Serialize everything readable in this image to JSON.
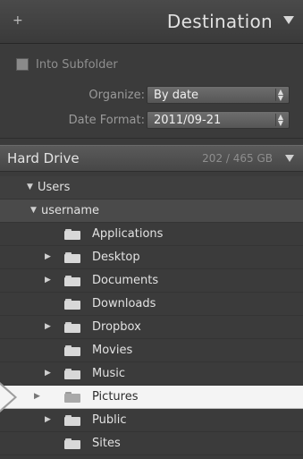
{
  "header": {
    "title": "Destination",
    "plus_icon": "plus-icon",
    "collapse_icon": "triangle-down-icon"
  },
  "subfolder": {
    "label": "Into Subfolder",
    "checked": true
  },
  "organize": {
    "label": "Organize:",
    "value": "By date"
  },
  "date_format": {
    "label": "Date Format:",
    "value": "2011/09-21"
  },
  "drive": {
    "name": "Hard Drive",
    "space": "202 / 465 GB"
  },
  "tree": {
    "users": "Users",
    "username": "username",
    "items": [
      {
        "label": "Applications",
        "expandable": false
      },
      {
        "label": "Desktop",
        "expandable": true
      },
      {
        "label": "Documents",
        "expandable": true
      },
      {
        "label": "Downloads",
        "expandable": false
      },
      {
        "label": "Dropbox",
        "expandable": true
      },
      {
        "label": "Movies",
        "expandable": false
      },
      {
        "label": "Music",
        "expandable": true
      },
      {
        "label": "Pictures",
        "expandable": true,
        "selected": true
      },
      {
        "label": "Public",
        "expandable": true
      },
      {
        "label": "Sites",
        "expandable": false
      }
    ]
  },
  "colors": {
    "panel": "#3b3b3b",
    "selected_row": "#f4f4f4",
    "header": "#4a4a4a"
  }
}
